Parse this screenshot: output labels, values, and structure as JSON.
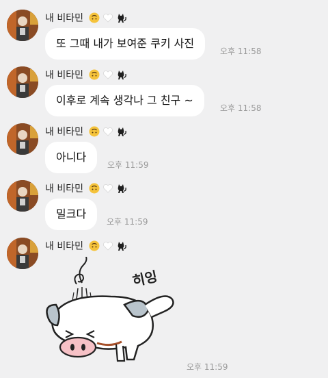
{
  "sender": {
    "name": "내 비타민",
    "emojis": [
      "upside-down-face",
      "white-heart",
      "black-cat"
    ]
  },
  "messages": [
    {
      "text": "또 그때 내가 보여준 쿠키 사진",
      "time": "오후 11:58"
    },
    {
      "text": "이후로 계속 생각나 그 친구 ~",
      "time": "오후 11:58"
    },
    {
      "text": "아니다",
      "time": "오후 11:59"
    },
    {
      "text": "밀크다",
      "time": "오후 11:59"
    }
  ],
  "sticker": {
    "caption": "히잉",
    "time": "오후 11:59",
    "icon": "crying-pig-sticker"
  },
  "colors": {
    "background": "#f0f0f1",
    "bubble": "#ffffff",
    "time": "#999999"
  }
}
